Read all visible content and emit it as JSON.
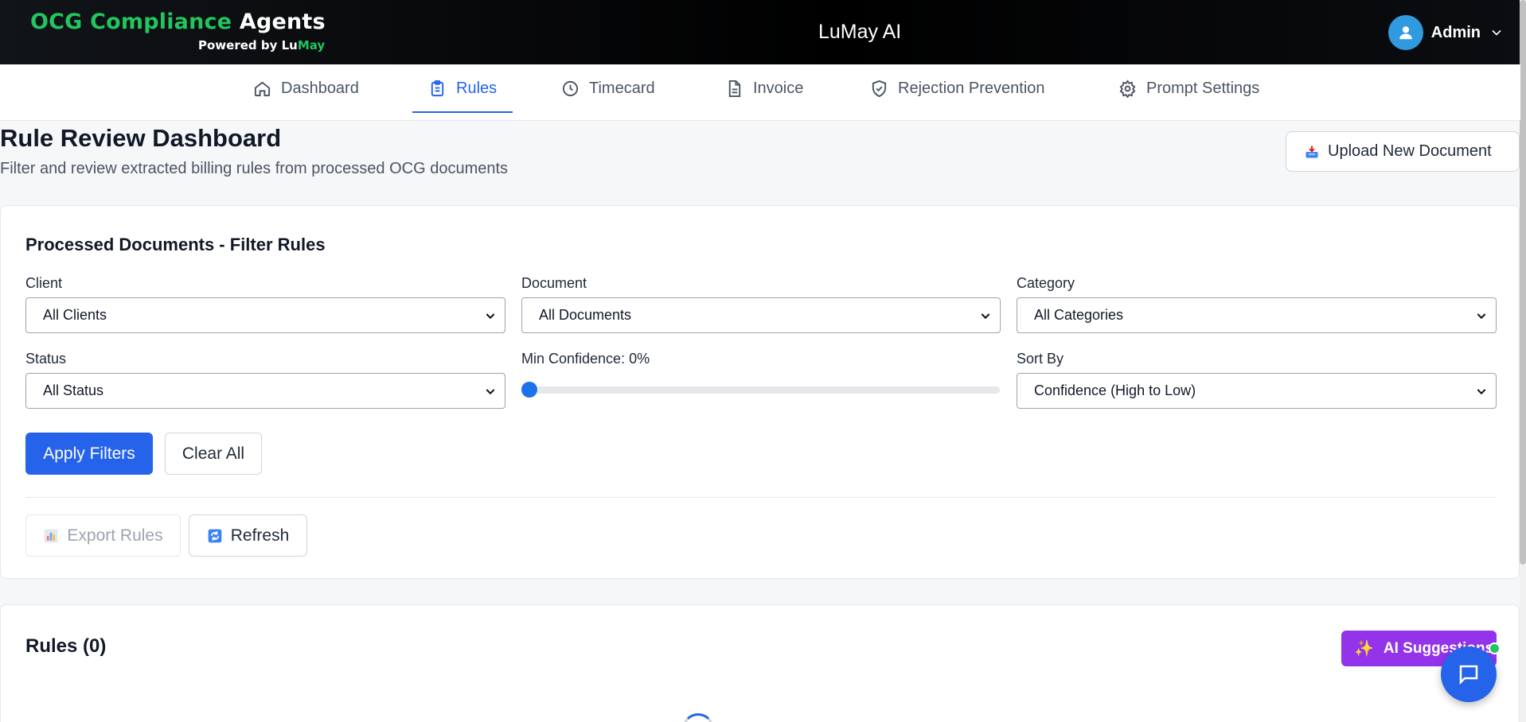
{
  "header": {
    "brand_part1": "OCG Compliance",
    "brand_part2": "Agents",
    "powered_prefix": "Powered by Lu",
    "powered_suffix": "May",
    "app_title": "LuMay AI",
    "user_name": "Admin"
  },
  "nav": {
    "tabs": [
      {
        "label": "Dashboard",
        "icon": "home-icon"
      },
      {
        "label": "Rules",
        "icon": "clipboard-icon",
        "active": true
      },
      {
        "label": "Timecard",
        "icon": "clock-icon"
      },
      {
        "label": "Invoice",
        "icon": "document-icon"
      },
      {
        "label": "Rejection Prevention",
        "icon": "shield-check-icon"
      },
      {
        "label": "Prompt Settings",
        "icon": "gear-icon"
      }
    ]
  },
  "page": {
    "title": "Rule Review Dashboard",
    "subtitle": "Filter and review extracted billing rules from processed OCG documents",
    "upload_button": "Upload New Document"
  },
  "filters": {
    "title": "Processed Documents - Filter Rules",
    "client_label": "Client",
    "client_value": "All Clients",
    "document_label": "Document",
    "document_value": "All Documents",
    "category_label": "Category",
    "category_value": "All Categories",
    "status_label": "Status",
    "status_value": "All Status",
    "confidence_label": "Min Confidence: 0%",
    "confidence_value": 0,
    "sort_label": "Sort By",
    "sort_value": "Confidence (High to Low)",
    "apply_button": "Apply Filters",
    "clear_button": "Clear All",
    "export_button": "Export Rules",
    "refresh_button": "Refresh"
  },
  "rules": {
    "title": "Rules (0)",
    "ai_button": "AI Suggestions"
  },
  "colors": {
    "primary": "#2563eb",
    "brand_green": "#22c55e",
    "ai_purple": "#9333ea"
  }
}
